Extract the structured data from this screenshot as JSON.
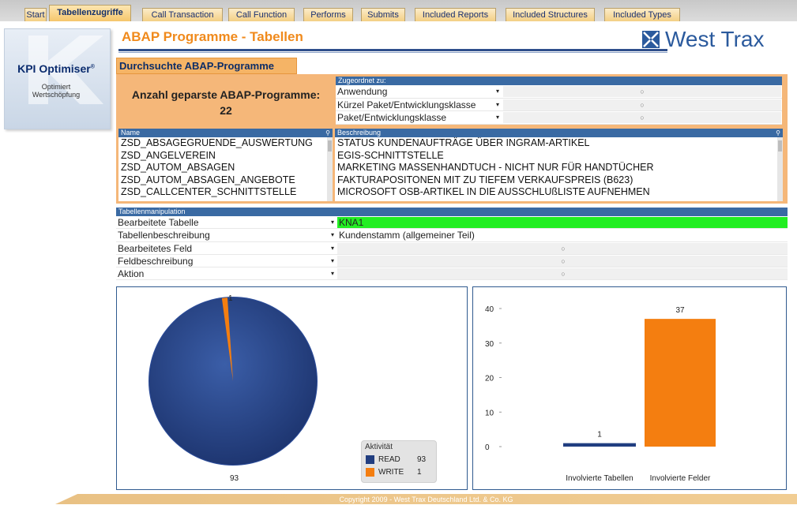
{
  "tabs": [
    {
      "label": "Start"
    },
    {
      "label": "Tabellenzugriffe",
      "active": true
    },
    {
      "label": "Call Transaction"
    },
    {
      "label": "Call Function"
    },
    {
      "label": "Performs"
    },
    {
      "label": "Submits"
    },
    {
      "label": "Included Reports"
    },
    {
      "label": "Included Structures"
    },
    {
      "label": "Included Types"
    }
  ],
  "logo": {
    "title": "KPI Optimiser",
    "registered": "®",
    "subtitle_line1": "Optimiert",
    "subtitle_line2": "Wertschöpfung"
  },
  "brand": {
    "name": "West Trax",
    "color": "#2b5a9d"
  },
  "page_title": "ABAP Programme - Tabellen",
  "section_title": "Durchsuchte ABAP-Programme",
  "count": {
    "label": "Anzahl geparste ABAP-Programme:",
    "value": "22"
  },
  "assign": {
    "header": "Zugeordnet zu:",
    "rows": [
      {
        "label": "Anwendung",
        "value": "○"
      },
      {
        "label": "Kürzel Paket/Entwicklungsklasse",
        "value": "○"
      },
      {
        "label": "Paket/Entwicklungsklasse",
        "value": "○"
      }
    ]
  },
  "name_list": {
    "header": "Name",
    "items": [
      "ZSD_ABSAGEGRUENDE_AUSWERTUNG",
      "ZSD_ANGELVEREIN",
      "ZSD_AUTOM_ABSAGEN",
      "ZSD_AUTOM_ABSAGEN_ANGEBOTE",
      "ZSD_CALLCENTER_SCHNITTSTELLE"
    ]
  },
  "desc_list": {
    "header": "Beschreibung",
    "items": [
      "STATUS KUNDENAUFTRÄGE ÜBER INGRAM-ARTIKEL",
      "EGIS-SCHNITTSTELLE",
      "MARKETING MASSENHANDTUCH - NICHT NUR FÜR HANDTÜCHER",
      "FAKTURAPOSITONEN MIT ZU TIEFEM VERKAUFSPREIS (B623)",
      "MICROSOFT OSB-ARTIKEL IN DIE AUSSCHLUßLISTE AUFNEHMEN"
    ]
  },
  "manip": {
    "header": "Tabellenmanipulation",
    "rows": [
      {
        "label": "Bearbeitete Tabelle",
        "value": "KNA1"
      },
      {
        "label": "Tabellenbeschreibung",
        "value": "Kundenstamm (allgemeiner Teil)"
      },
      {
        "label": "Bearbeitetes Feld",
        "value": "○"
      },
      {
        "label": "Feldbeschreibung",
        "value": "○"
      },
      {
        "label": "Aktion",
        "value": "○"
      }
    ]
  },
  "colors": {
    "read": "#213e80",
    "write": "#f47e10",
    "orange_bg": "#f5b779",
    "header_blue": "#3a6aa3"
  },
  "chart_data": [
    {
      "type": "pie",
      "legend_title": "Aktivität",
      "legend_position": "bottom-right",
      "slices": [
        {
          "name": "READ",
          "value": 93
        },
        {
          "name": "WRITE",
          "value": 1
        }
      ]
    },
    {
      "type": "bar",
      "categories": [
        "Involvierte Tabellen",
        "Involvierte Felder"
      ],
      "values": [
        1,
        37
      ],
      "ylim": [
        0,
        40
      ],
      "yticks": [
        "0",
        "10",
        "20",
        "30",
        "40"
      ]
    }
  ],
  "footer": "Copyright 2009 - West Trax Deutschland Ltd. & Co. KG"
}
